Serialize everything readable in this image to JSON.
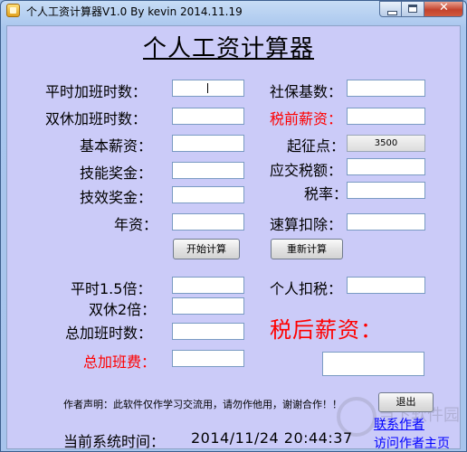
{
  "window": {
    "title": "个人工资计算器V1.0 By kevin 2014.11.19",
    "icon": "calculator-app-icon",
    "controls": {
      "minimize": "minimize-icon",
      "maximize": "maximize-icon",
      "close_glyph": "✕"
    }
  },
  "heading": "个人工资计算器",
  "form_left": {
    "overtime_weekday_label": "平时加班时数：",
    "overtime_weekend_label": "双休加班时数：",
    "base_salary_label": "基本薪资：",
    "skill_bonus_label": "技能奖金：",
    "performance_bonus_label": "技效奖金：",
    "seniority_label": "年资："
  },
  "form_right": {
    "social_security_label": "社保基数：",
    "pretax_label": "税前薪资：",
    "threshold_label": "起征点：",
    "threshold_value": "3500",
    "taxable_label": "应交税额：",
    "tax_rate_label": "税率：",
    "quick_deduction_label": "速算扣除："
  },
  "buttons": {
    "start": "开始计算",
    "reset": "重新计算",
    "exit": "退出"
  },
  "results": {
    "weekday_15x_label": "平时1.5倍：",
    "weekend_2x_label": "双休2倍：",
    "total_hours_label": "总加班时数：",
    "total_pay_label": "总加班费：",
    "personal_tax_label": "个人扣税：",
    "after_tax_label": "税后薪资："
  },
  "notice": "作者声明：此软件仅作学习交流用，请勿作他用，谢谢合作！！",
  "time": {
    "label": "当前系统时间：",
    "value": "2014/11/24 20:44:37"
  },
  "links": {
    "contact": "联系作者",
    "homepage": "访问作者主页"
  },
  "watermark": "当下软件园",
  "colors": {
    "client_bg": "#cbcbf8",
    "highlight_red": "#ff0000",
    "link_blue": "#0000ff"
  }
}
